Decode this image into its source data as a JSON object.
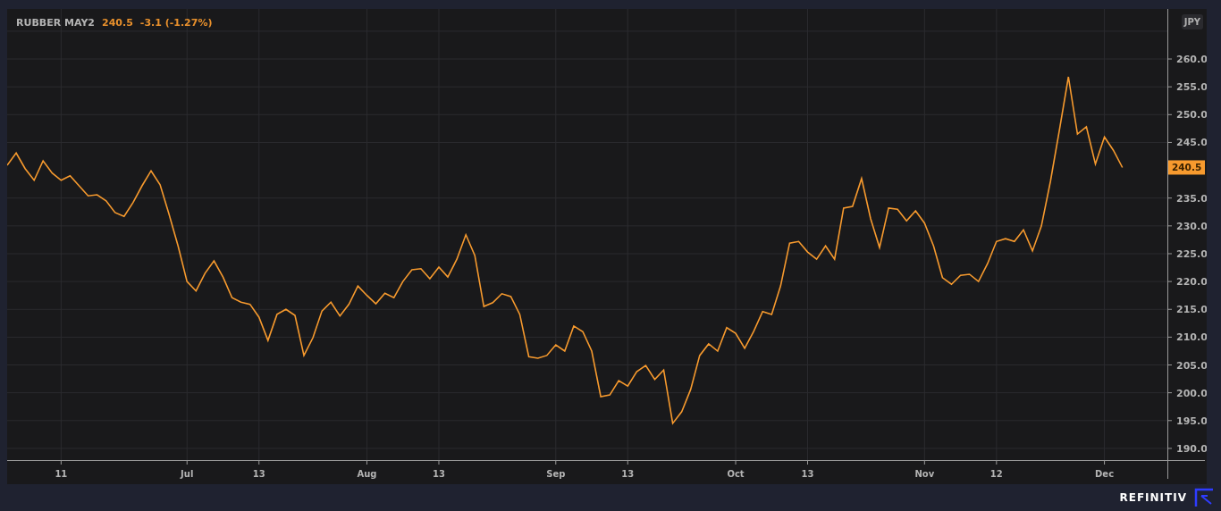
{
  "legend": {
    "last": "240.5",
    "change": "-3.1 (-1.27%)"
  },
  "currency": "JPY",
  "price_marker": "240.5",
  "chart_data": {
    "type": "line",
    "grid": true,
    "ylim": [
      187.9,
      269.0
    ],
    "categories": [
      null,
      null,
      null,
      null,
      null,
      null,
      "11",
      null,
      null,
      null,
      null,
      null,
      null,
      null,
      null,
      null,
      null,
      null,
      null,
      null,
      "Jul",
      null,
      null,
      null,
      null,
      null,
      null,
      null,
      "13",
      null,
      null,
      null,
      null,
      null,
      null,
      null,
      null,
      null,
      null,
      null,
      "Aug",
      null,
      null,
      null,
      null,
      null,
      null,
      null,
      "13",
      null,
      null,
      null,
      null,
      null,
      null,
      null,
      null,
      null,
      null,
      null,
      null,
      "Sep",
      null,
      null,
      null,
      null,
      null,
      null,
      null,
      "13",
      null,
      null,
      null,
      null,
      null,
      null,
      null,
      null,
      null,
      null,
      null,
      "Oct",
      null,
      null,
      null,
      null,
      null,
      null,
      null,
      "13",
      null,
      null,
      null,
      null,
      null,
      null,
      null,
      null,
      null,
      null,
      null,
      null,
      "Nov",
      null,
      null,
      null,
      null,
      null,
      null,
      null,
      "12",
      null,
      null,
      null,
      null,
      null,
      null,
      null,
      null,
      null,
      null,
      null,
      "Dec",
      null,
      null
    ],
    "yticks": [
      {
        "value": 190,
        "label": "190.0"
      },
      {
        "value": 195,
        "label": "195.0"
      },
      {
        "value": 200,
        "label": "200.0"
      },
      {
        "value": 205,
        "label": "205.0"
      },
      {
        "value": 210,
        "label": "210.0"
      },
      {
        "value": 215,
        "label": "215.0"
      },
      {
        "value": 220,
        "label": "220.0"
      },
      {
        "value": 225,
        "label": "225.0"
      },
      {
        "value": 230,
        "label": "230.0"
      },
      {
        "value": 235,
        "label": "235.0"
      },
      {
        "value": 245,
        "label": "245.0"
      },
      {
        "value": 250,
        "label": "250.0"
      },
      {
        "value": 255,
        "label": "255.0"
      },
      {
        "value": 260,
        "label": "260.0"
      }
    ],
    "series": [
      {
        "name": "RUBBER MAY2",
        "color": "#f79a2e",
        "values": [
          240.9,
          243.1,
          240.3,
          238.2,
          241.7,
          239.5,
          238.2,
          239.0,
          237.2,
          235.4,
          235.6,
          234.5,
          232.4,
          231.7,
          234.2,
          237.2,
          239.9,
          237.4,
          232.1,
          226.4,
          220.0,
          218.3,
          221.5,
          223.7,
          220.8,
          217.1,
          216.3,
          215.9,
          213.6,
          209.4,
          214.1,
          215.0,
          213.9,
          206.7,
          209.9,
          214.7,
          216.3,
          213.8,
          215.9,
          219.2,
          217.5,
          216.0,
          217.9,
          217.1,
          220.0,
          222.1,
          222.3,
          220.5,
          222.6,
          220.8,
          224.0,
          228.4,
          224.7,
          215.5,
          216.2,
          217.8,
          217.3,
          214.1,
          206.5,
          206.2,
          206.7,
          208.6,
          207.5,
          212.0,
          211.0,
          207.5,
          199.3,
          199.6,
          202.2,
          201.2,
          203.8,
          204.9,
          202.4,
          204.1,
          194.5,
          196.6,
          200.6,
          206.7,
          208.8,
          207.5,
          211.7,
          210.7,
          208.0,
          211.0,
          214.6,
          214.1,
          219.2,
          226.9,
          227.2,
          225.3,
          224.0,
          226.4,
          224.0,
          233.2,
          233.5,
          238.5,
          231.3,
          226.1,
          233.2,
          233.0,
          230.9,
          232.7,
          230.5,
          226.4,
          220.7,
          219.5,
          221.1,
          221.3,
          220.0,
          223.2,
          227.2,
          227.7,
          227.2,
          229.3,
          225.5,
          230.0,
          238.0,
          247.3,
          256.8,
          246.5,
          247.8,
          241.1,
          246.0,
          243.6,
          240.5
        ]
      }
    ]
  },
  "footer": {
    "brand": "REFINITIV"
  }
}
